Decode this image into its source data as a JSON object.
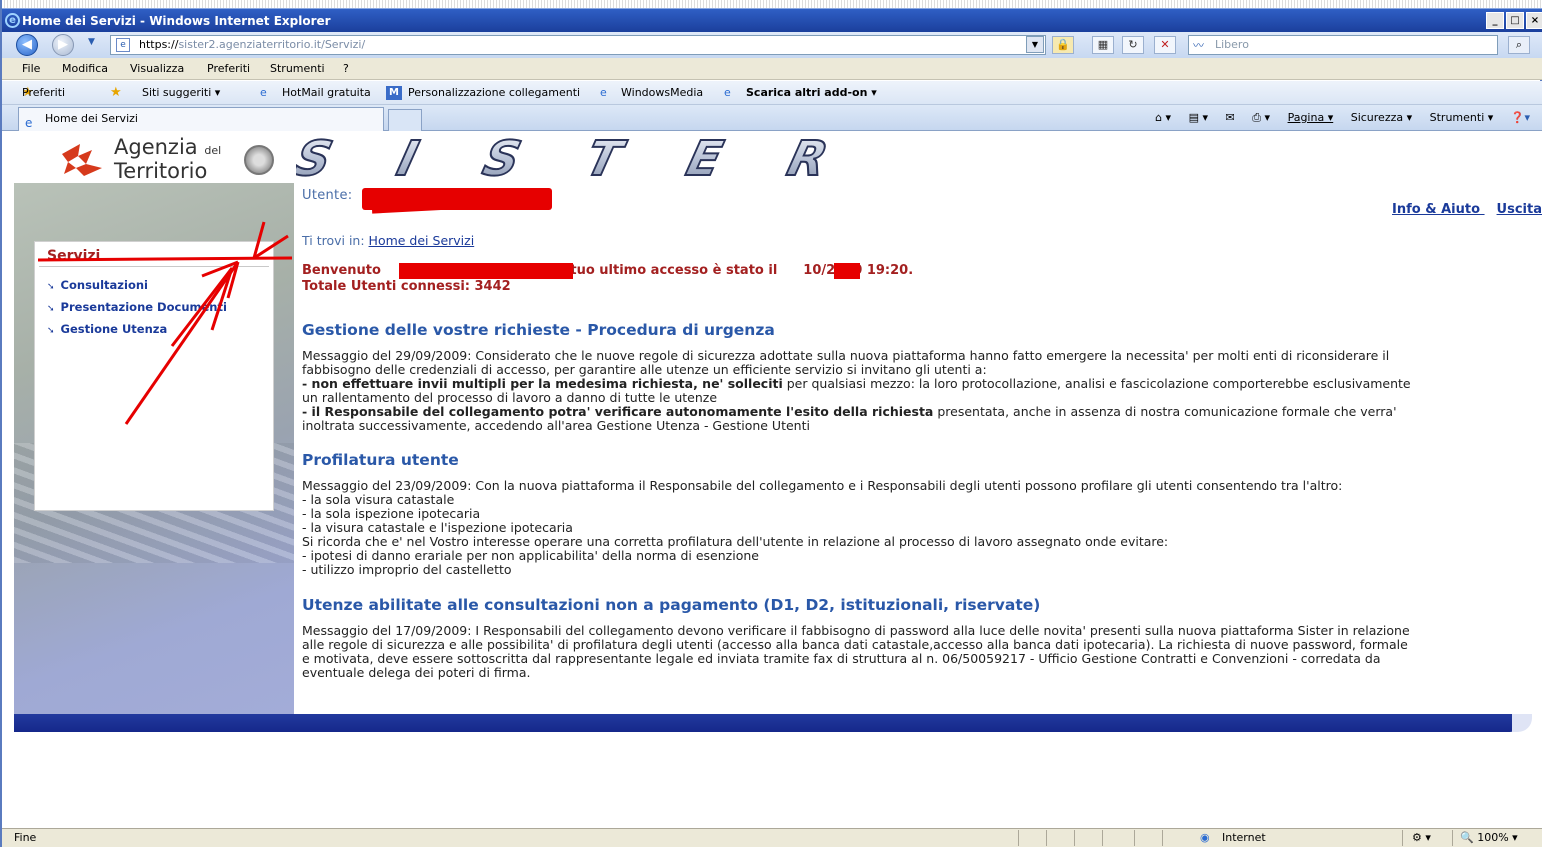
{
  "window": {
    "title": "Home dei Servizi - Windows Internet Explorer",
    "controls": [
      "_",
      "□",
      "×"
    ]
  },
  "address_bar": {
    "url_prefix": "https://",
    "url_host": "sister2.agenziaterritorio.it",
    "url_path": "/Servizi/",
    "search_placeholder": "Libero"
  },
  "menu": [
    "File",
    "Modifica",
    "Visualizza",
    "Preferiti",
    "Strumenti",
    "?"
  ],
  "favorites_bar": {
    "favorites_label": "Preferiti",
    "items": [
      "Siti suggeriti ▾",
      "HotMail gratuita",
      "Personalizzazione collegamenti",
      "WindowsMedia",
      "Scarica altri add-on ▾"
    ]
  },
  "tab": {
    "label": "Home dei Servizi"
  },
  "tab_tools": [
    "Pagina ▾",
    "Sicurezza ▾",
    "Strumenti ▾"
  ],
  "logo": {
    "line1": "Agenzia",
    "del": "del",
    "line2": "Territorio",
    "brand": "SISTER"
  },
  "sidebar": {
    "title": "Servizi",
    "items": [
      {
        "label": "Consultazioni"
      },
      {
        "label": "Presentazione Documenti"
      },
      {
        "label": "Gestione Utenza"
      }
    ]
  },
  "header": {
    "utente_label": "Utente:",
    "links": [
      "Info & Aiuto",
      "Uscita"
    ],
    "trovi_prefix": "Ti trovi in:",
    "trovi_link": "Home dei Servizi"
  },
  "welcome": {
    "prefix": "Benvenuto",
    "middle": "il tuo ultimo accesso è stato il",
    "suffix": "10/2010 19:20.",
    "connected": "Totale  Utenti connessi: 3442"
  },
  "sections": [
    {
      "heading": "Gestione delle vostre richieste - Procedura di urgenza",
      "lines": [
        "Messaggio del 29/09/2009: Considerato che le nuove regole di sicurezza adottate sulla nuova piattaforma hanno fatto emergere la necessita' per molti enti di riconsiderare il",
        "fabbisogno delle credenziali di accesso, per garantire alle utenze un efficiente servizio si invitano gli utenti a:"
      ],
      "bullet1_bold": "- non effettuare invii multipli per la medesima richiesta, ne' solleciti",
      "bullet1_rest": " per qualsiasi mezzo: la loro protocollazione, analisi e fascicolazione comporterebbe esclusivamente",
      "bullet1_line2": "un rallentamento del processo di lavoro a danno di tutte le utenze",
      "bullet2_bold": "- il Responsabile del collegamento potra' verificare autonomamente l'esito della richiesta",
      "bullet2_rest": " presentata, anche in assenza di nostra comunicazione formale che verra'",
      "bullet2_line2": "inoltrata successivamente, accedendo all'area Gestione Utenza - Gestione Utenti"
    },
    {
      "heading": "Profilatura utente",
      "text": "Messaggio del 23/09/2009: Con la nuova piattaforma il Responsabile del collegamento e i Responsabili degli utenti possono profilare gli utenti consentendo tra l'altro:\n- la sola visura catastale\n- la sola ispezione ipotecaria\n- la visura catastale e l'ispezione ipotecaria\nSi ricorda che e' nel Vostro interesse operare una corretta profilatura dell'utente in relazione al processo di lavoro assegnato onde evitare:\n- ipotesi di danno erariale per non applicabilita' della norma di esenzione\n- utilizzo improprio del castelletto"
    },
    {
      "heading": "Utenze abilitate alle consultazioni non a pagamento (D1, D2, istituzionali, riservate)",
      "text": "Messaggio del 17/09/2009: I Responsabili del collegamento devono verificare il fabbisogno di password alla luce delle novita' presenti sulla nuova piattaforma Sister in relazione\nalle regole di sicurezza e alle possibilita' di profilatura degli utenti (accesso alla banca dati catastale,accesso alla banca dati ipotecaria). La richiesta di nuove password, formale\ne motivata, deve essere sottoscritta dal rappresentante legale ed inviata tramite fax di struttura al n. 06/50059217 - Ufficio Gestione Contratti e Convenzioni - corredata da\neventuale delega dei poteri di firma."
    }
  ],
  "status_bar": {
    "left": "Fine",
    "zone": "Internet",
    "zoom": "100%"
  },
  "colors": {
    "heading_blue": "#2a58a8",
    "brand_red": "#a32020",
    "link_blue": "#1a3a9a",
    "footer_bar": "#1a2f95",
    "annotation_red": "#e60000"
  }
}
